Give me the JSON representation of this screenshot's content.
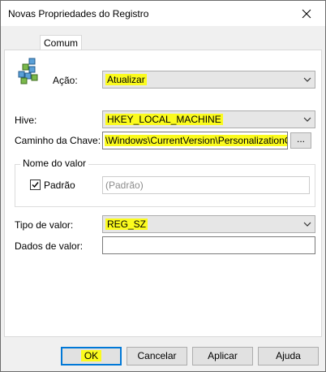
{
  "window": {
    "title": "Novas Propriedades do Registro",
    "close_icon": "close-icon"
  },
  "tabs": [
    {
      "label": "Comum"
    }
  ],
  "form": {
    "action": {
      "label": "Ação:",
      "value": "Atualizar",
      "icon": "registry-icon"
    },
    "hive": {
      "label": "Hive:",
      "value": "HKEY_LOCAL_MACHINE"
    },
    "key_path": {
      "label": "Caminho da Chave:",
      "value": "\\Windows\\CurrentVersion\\PersonalizationCSP",
      "browse_label": "..."
    },
    "value_name_group": {
      "label": "Nome do valor",
      "default_checkbox_label": "Padrão",
      "default_checked": true,
      "default_placeholder": "(Padrão)"
    },
    "value_type": {
      "label": "Tipo de valor:",
      "value": "REG_SZ"
    },
    "value_data": {
      "label": "Dados de valor:",
      "value": ""
    }
  },
  "buttons": {
    "ok": "OK",
    "cancel": "Cancelar",
    "apply": "Aplicar",
    "help": "Ajuda"
  },
  "colors": {
    "highlight": "#fbfb1e",
    "default_button_border": "#0078d7"
  }
}
